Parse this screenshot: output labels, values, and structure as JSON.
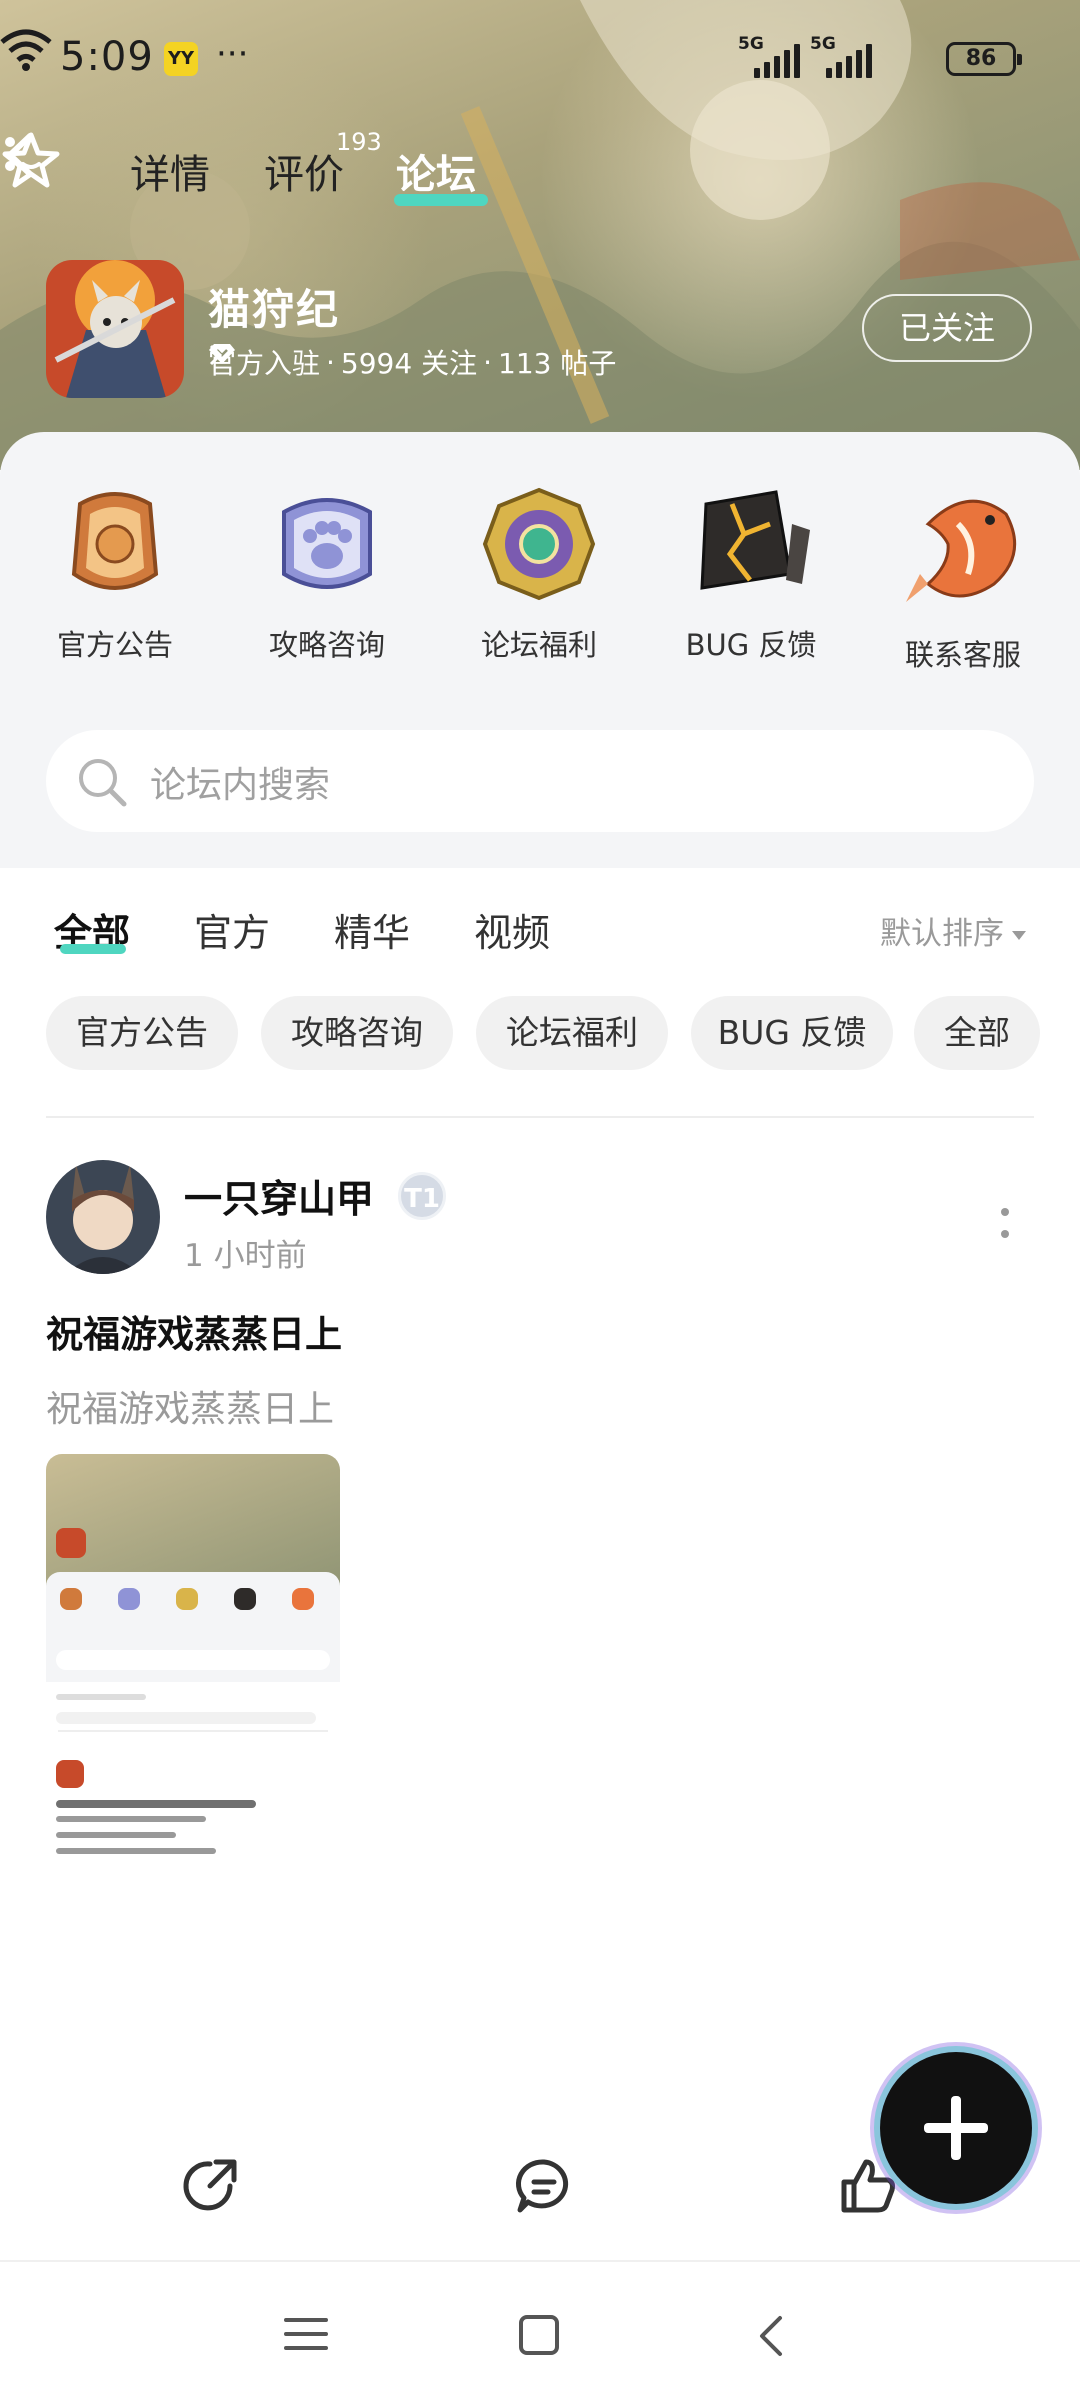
{
  "status_bar": {
    "time": "5:09",
    "app_badge": "YY",
    "more": "···",
    "signal1_label": "5G",
    "signal2_label": "5G",
    "battery": "86"
  },
  "nav": {
    "tabs": [
      {
        "label": "详情"
      },
      {
        "label": "评价",
        "count": "193"
      },
      {
        "label": "论坛",
        "active": true
      }
    ]
  },
  "game": {
    "name": "猫狩纪",
    "verified": "官方入驻",
    "followers": "5994 关注",
    "posts": "113 帖子",
    "follow_button": "已关注"
  },
  "quick_links": [
    {
      "label": "官方公告",
      "icon": "announcement-badge-icon"
    },
    {
      "label": "攻略咨询",
      "icon": "paw-badge-icon"
    },
    {
      "label": "论坛福利",
      "icon": "gem-medal-icon"
    },
    {
      "label": "BUG 反馈",
      "icon": "cracked-stone-icon"
    },
    {
      "label": "联系客服",
      "icon": "koi-fish-icon"
    }
  ],
  "search": {
    "placeholder": "论坛内搜索"
  },
  "content_tabs": [
    {
      "label": "全部",
      "active": true
    },
    {
      "label": "官方"
    },
    {
      "label": "精华"
    },
    {
      "label": "视频"
    }
  ],
  "sort_label": "默认排序",
  "chips": [
    "官方公告",
    "攻略咨询",
    "论坛福利",
    "BUG 反馈",
    "全部"
  ],
  "post": {
    "author": "一只穿山甲",
    "level": "T1",
    "time": "1 小时前",
    "title": "祝福游戏蒸蒸日上",
    "body": "祝福游戏蒸蒸日上"
  },
  "colors": {
    "accent": "#4fd6c0",
    "hero_bg": "#a9a27b",
    "panel_bg": "#f4f5f7",
    "chip_bg": "#f1f1f1"
  }
}
